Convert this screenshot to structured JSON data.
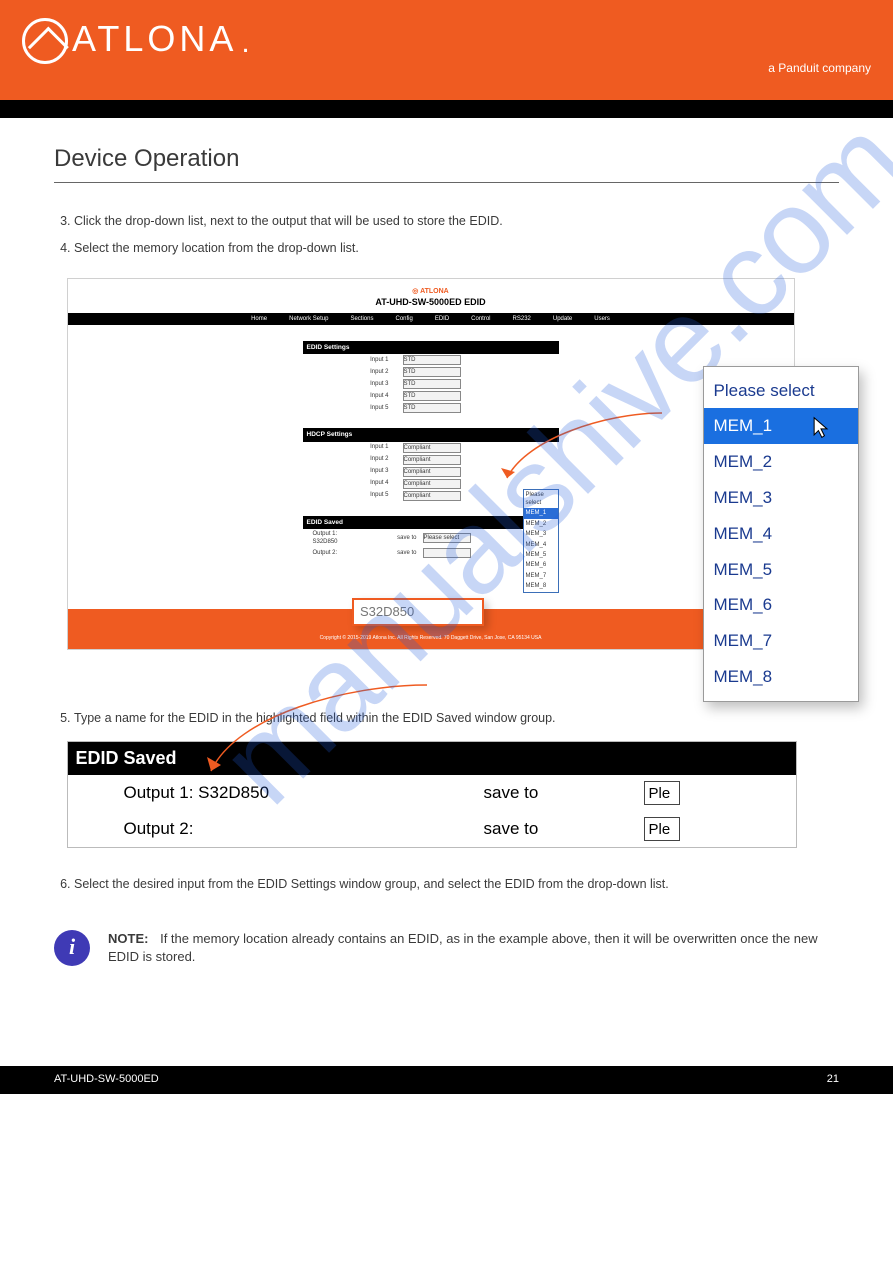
{
  "brand": {
    "name": "ATLONA",
    "sub": "a Panduit company",
    "full_dot": "."
  },
  "section_title": "Device Operation",
  "steps_a": [
    "Click the drop-down list, next to the output that will be used to store the EDID.",
    "Select the memory location from the drop-down list."
  ],
  "steps_b": [
    "Type a name for the EDID in the highlighted field within the EDID Saved window group.",
    "Select the desired input from the EDID Settings window group, and select the EDID from the drop-down list."
  ],
  "note_label": "NOTE:",
  "note_text": "If the memory location already contains an EDID, as in the example above, then it will be overwritten once the new EDID is stored.",
  "shot": {
    "logo": "ATLONA",
    "title": "AT-UHD-SW-5000ED EDID",
    "nav": [
      "Home",
      "Network Setup",
      "Sections",
      "Config",
      "EDID",
      "Control",
      "RS232",
      "Update",
      "Users"
    ],
    "edid_head": "EDID Settings",
    "edid_rows": [
      "Input 1",
      "Input 2",
      "Input 3",
      "Input 4",
      "Input 5"
    ],
    "edid_val": "STD",
    "hdcp_head": "HDCP Settings",
    "hdcp_rows": [
      "Input 1",
      "Input 2",
      "Input 3",
      "Input 4",
      "Input 5"
    ],
    "hdcp_val": "Compliant",
    "saved_head": "EDID Saved",
    "out1": "Output 1:  S32D850",
    "out2": "Output 2:",
    "save_to": "save to",
    "please": "Please select",
    "mem": [
      "MEM_1",
      "MEM_2",
      "MEM_3",
      "MEM_4",
      "MEM_5",
      "MEM_6",
      "MEM_7",
      "MEM_8"
    ],
    "footer": "Copyright © 2015-2019 Atlona Inc. All Rights Reserved. 70 Daggett Drive, San Jose, CA 95134 USA"
  },
  "popup": {
    "title": "Please select",
    "items": [
      "MEM_1",
      "MEM_2",
      "MEM_3",
      "MEM_4",
      "MEM_5",
      "MEM_6",
      "MEM_7",
      "MEM_8"
    ]
  },
  "search_box": "S32D850",
  "panel2": {
    "head": "EDID Saved",
    "r1": {
      "label": "Output 1:  S32D850",
      "save": "save to",
      "td": "Ple"
    },
    "r2": {
      "label": "Output 2:",
      "save": "save to",
      "td": "Ple"
    }
  },
  "watermark": "manualshive.com",
  "footer": {
    "left": "AT-UHD-SW-5000ED",
    "right": "21"
  }
}
